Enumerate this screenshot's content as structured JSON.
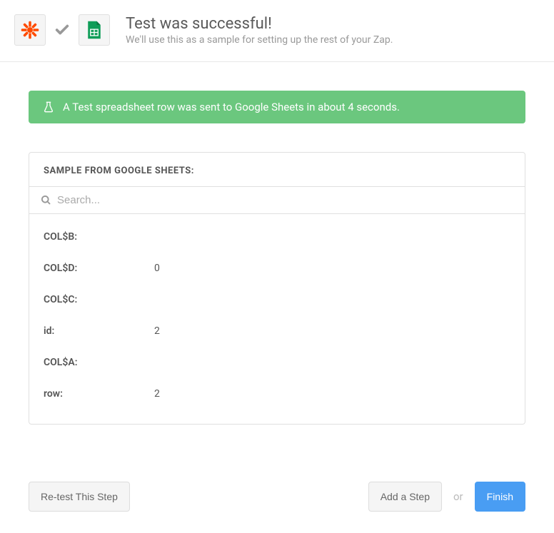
{
  "header": {
    "title": "Test was successful!",
    "subtitle": "We'll use this as a sample for setting up the rest of your Zap."
  },
  "banner": {
    "message": "A Test spreadsheet row was sent to Google Sheets in about 4 seconds."
  },
  "sample": {
    "heading": "SAMPLE FROM GOOGLE SHEETS:",
    "search_placeholder": "Search...",
    "fields": [
      {
        "key": "COL$B:",
        "value": ""
      },
      {
        "key": "COL$D:",
        "value": "0"
      },
      {
        "key": "COL$C:",
        "value": ""
      },
      {
        "key": "id:",
        "value": "2"
      },
      {
        "key": "COL$A:",
        "value": ""
      },
      {
        "key": "row:",
        "value": "2"
      }
    ]
  },
  "footer": {
    "retest": "Re-test This Step",
    "add_step": "Add a Step",
    "or": "or",
    "finish": "Finish"
  }
}
